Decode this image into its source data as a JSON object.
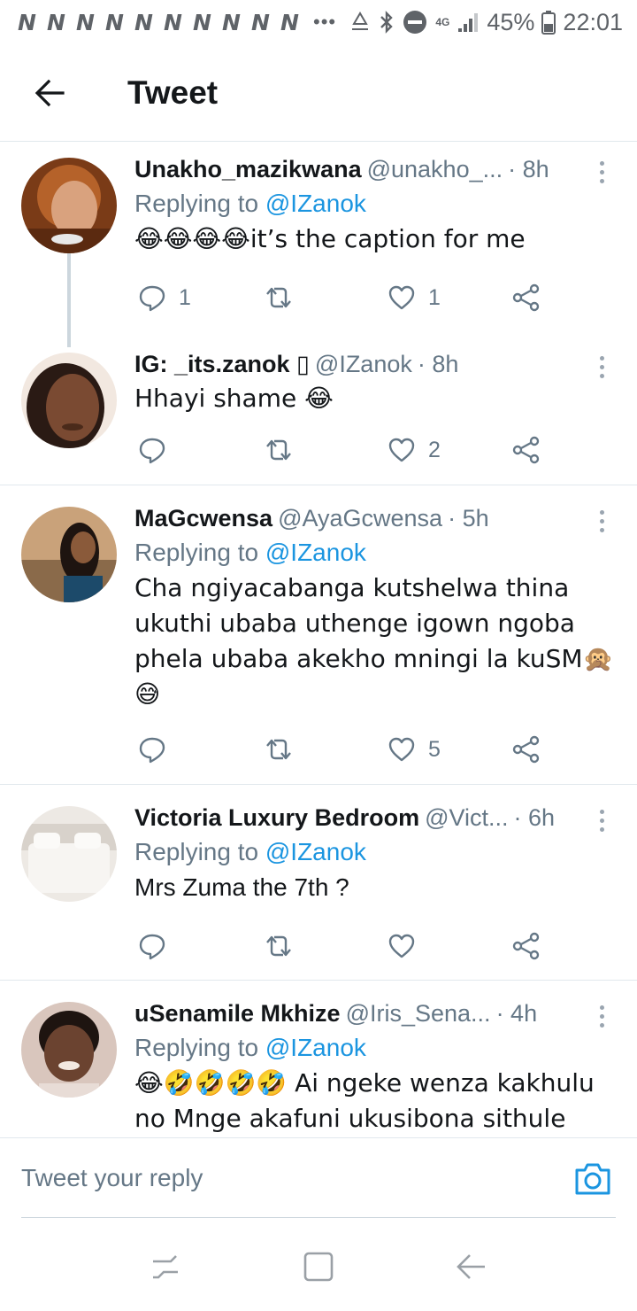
{
  "status_bar": {
    "notifications": [
      "N",
      "N",
      "N",
      "N",
      "N",
      "N",
      "N",
      "N",
      "N",
      "N"
    ],
    "dots": "•••",
    "network": "4G",
    "battery": "45%",
    "time": "22:01",
    "battery_level": 0.45
  },
  "header": {
    "title": "Tweet"
  },
  "tweets": [
    {
      "user": "Unakho_mazikwana",
      "handle": "@unakho_...",
      "time": "· 8h",
      "replying_label": "Replying to ",
      "replying_to": "@IZanok",
      "text": "😂😂😂😂it’s the caption for me",
      "replies": "1",
      "retweets": "",
      "likes": "1"
    },
    {
      "user": "IG: _its.zanok ▯",
      "handle": "@IZanok",
      "time": "· 8h",
      "replying_label": "",
      "replying_to": "",
      "text": "Hhayi shame 😂",
      "replies": "",
      "retweets": "",
      "likes": "2"
    },
    {
      "user": "MaGcwensa",
      "handle": "@AyaGcwensa",
      "time": "· 5h",
      "replying_label": "Replying to ",
      "replying_to": "@IZanok",
      "text_lines": [
        "Cha ngiyacabanga kutshelwa thina",
        "ukuthi ubaba uthenge igown ngoba",
        "phela ubaba akekho mningi la kuSM🙊",
        "😅"
      ],
      "replies": "",
      "retweets": "",
      "likes": "5"
    },
    {
      "user": "Victoria Luxury Bedroom",
      "handle": "@Vict...",
      "time": "· 6h",
      "replying_label": "Replying to ",
      "replying_to": "@IZanok",
      "text": "Mrs Zuma the 7th ?",
      "replies": "",
      "retweets": "",
      "likes": ""
    },
    {
      "user": "uSenamile Mkhize",
      "handle": "@Iris_Sena...",
      "time": "· 4h",
      "replying_label": "Replying to ",
      "replying_to": "@IZanok",
      "text_lines": [
        "😂🤣🤣🤣🤣 Ai ngeke wenza kakhulu",
        "no Mnge akafuni ukusibona sithule"
      ],
      "replies": "",
      "retweets": "",
      "likes": ""
    }
  ],
  "reply_bar": {
    "placeholder": "Tweet your reply"
  },
  "icons": {
    "back": "arrow-left-icon",
    "more": "more-vertical-icon",
    "reply": "reply-bubble-icon",
    "retweet": "retweet-icon",
    "like": "heart-icon",
    "share": "share-icon",
    "camera": "camera-icon",
    "recents": "recents-icon",
    "home": "home-square-icon",
    "nav_back": "nav-back-icon"
  },
  "colors": {
    "accent": "#1b95e0",
    "secondary_text": "#657786",
    "primary_text": "#14171a",
    "divider": "#e1e8ed"
  }
}
